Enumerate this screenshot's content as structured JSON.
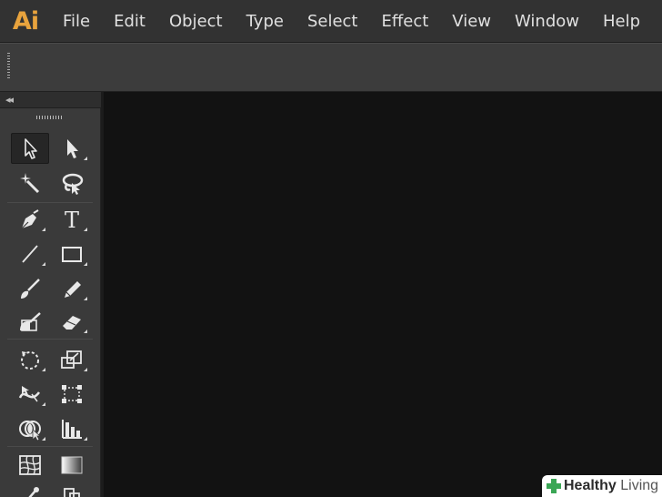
{
  "app": {
    "logo": "Ai",
    "accent_color": "#e8a33d"
  },
  "menu": [
    "File",
    "Edit",
    "Object",
    "Type",
    "Select",
    "Effect",
    "View",
    "Window",
    "Help"
  ],
  "tools_panel": {
    "collapse_glyph": "◂◂",
    "tools": [
      {
        "name": "selection-tool",
        "icon": "selection-arrow-icon",
        "selected": true
      },
      {
        "name": "direct-selection-tool",
        "icon": "direct-selection-arrow-icon"
      },
      {
        "name": "magic-wand-tool",
        "icon": "magic-wand-icon"
      },
      {
        "name": "lasso-tool",
        "icon": "lasso-icon"
      },
      {
        "name": "pen-tool",
        "icon": "pen-nib-icon"
      },
      {
        "name": "type-tool",
        "icon": "type-T-icon",
        "glyph": "T"
      },
      {
        "name": "line-segment-tool",
        "icon": "line-segment-icon"
      },
      {
        "name": "rectangle-tool",
        "icon": "rectangle-icon"
      },
      {
        "name": "paintbrush-tool",
        "icon": "paintbrush-icon"
      },
      {
        "name": "pencil-tool",
        "icon": "pencil-icon"
      },
      {
        "name": "blob-brush-tool",
        "icon": "blob-brush-icon"
      },
      {
        "name": "eraser-tool",
        "icon": "eraser-icon"
      },
      {
        "name": "rotate-tool",
        "icon": "rotate-icon"
      },
      {
        "name": "scale-tool",
        "icon": "scale-icon"
      },
      {
        "name": "width-tool",
        "icon": "width-icon"
      },
      {
        "name": "free-transform-tool",
        "icon": "free-transform-icon"
      },
      {
        "name": "shape-builder-tool",
        "icon": "shape-builder-icon"
      },
      {
        "name": "graph-tool",
        "icon": "column-graph-icon"
      },
      {
        "name": "mesh-tool",
        "icon": "mesh-icon"
      },
      {
        "name": "gradient-tool",
        "icon": "gradient-icon"
      }
    ]
  },
  "watermark": {
    "bold": "Healthy",
    "rest": " Living"
  }
}
